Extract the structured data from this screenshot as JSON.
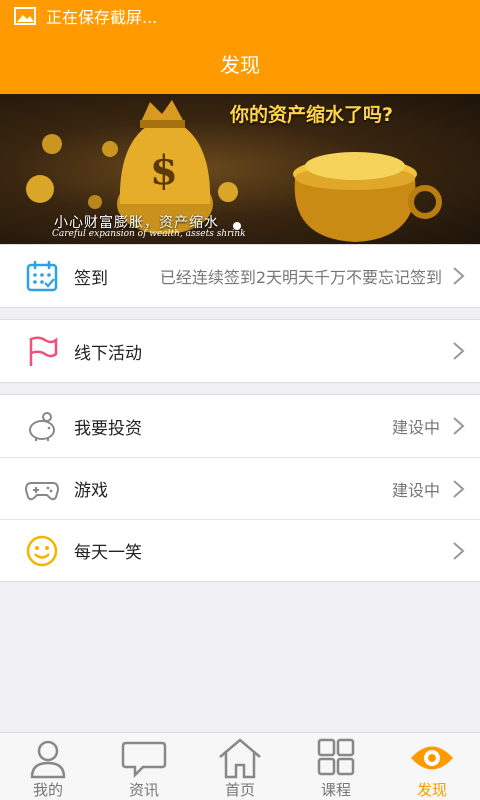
{
  "status_bar": {
    "text": "正在保存截屏..."
  },
  "header": {
    "title": "发现"
  },
  "banner": {
    "headline": "你的资产缩水了吗?",
    "caption_cn": "小心财富膨胀，资产缩水",
    "caption_en": "Careful expansion of wealth, assets shrink"
  },
  "list": {
    "checkin": {
      "label": "签到",
      "detail": "已经连续签到2天明天千万不要忘记签到"
    },
    "offline": {
      "label": "线下活动"
    },
    "invest": {
      "label": "我要投资",
      "detail": "建设中"
    },
    "game": {
      "label": "游戏",
      "detail": "建设中"
    },
    "joke": {
      "label": "每天一笑"
    }
  },
  "bottom_nav": [
    {
      "label": "我的",
      "icon": "person-icon"
    },
    {
      "label": "资讯",
      "icon": "chat-bubble-icon"
    },
    {
      "label": "首页",
      "icon": "home-icon"
    },
    {
      "label": "课程",
      "icon": "grid-icon"
    },
    {
      "label": "发现",
      "icon": "eye-icon",
      "active": true
    }
  ],
  "colors": {
    "accent": "#ff9a00",
    "checkin_icon": "#2aa3e6",
    "flag_icon": "#f0507a",
    "smile_icon": "#f5b400"
  }
}
